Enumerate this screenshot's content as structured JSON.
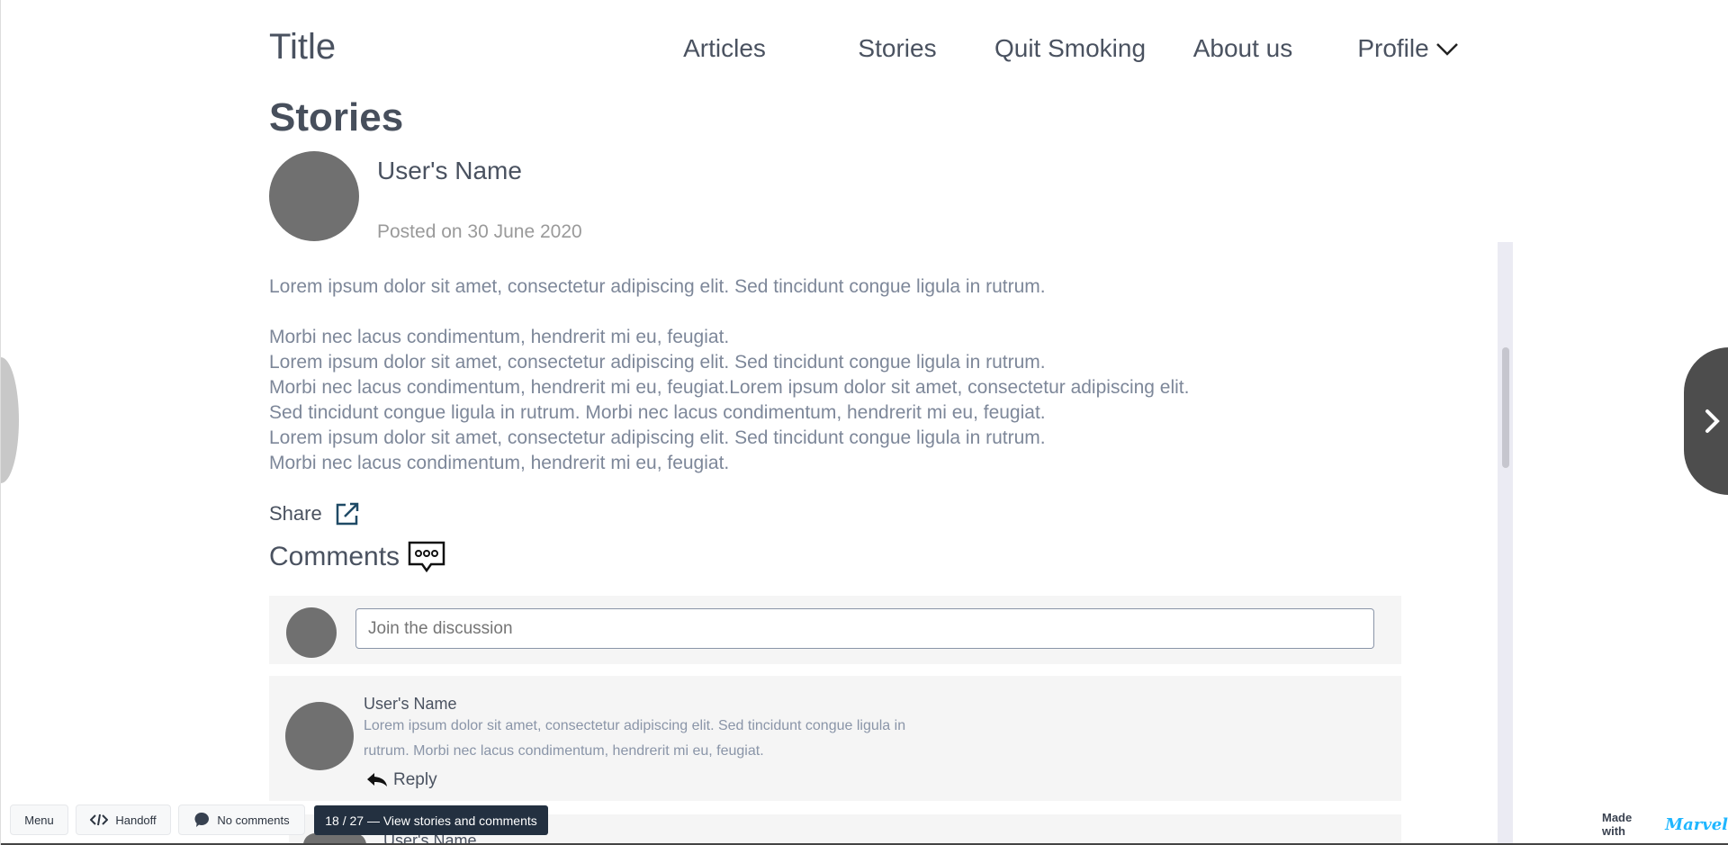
{
  "header": {
    "title": "Title",
    "nav": [
      "Articles",
      "Stories",
      "Quit Smoking",
      "About us",
      "Profile"
    ]
  },
  "page": {
    "heading": "Stories"
  },
  "post": {
    "user_name": "User's Name",
    "posted": "Posted on 30 June 2020",
    "body": "Lorem ipsum dolor sit amet, consectetur adipiscing elit. Sed tincidunt congue ligula in rutrum.\n\nMorbi nec lacus condimentum, hendrerit mi eu, feugiat.\nLorem ipsum dolor sit amet, consectetur adipiscing elit. Sed tincidunt congue ligula in rutrum.\nMorbi nec lacus condimentum, hendrerit mi eu, feugiat.Lorem ipsum dolor sit amet, consectetur adipiscing elit.\nSed tincidunt congue ligula in rutrum. Morbi nec lacus condimentum, hendrerit mi eu, feugiat.\nLorem ipsum dolor sit amet, consectetur adipiscing elit. Sed tincidunt congue ligula in rutrum.\nMorbi nec lacus condimentum, hendrerit mi eu, feugiat.",
    "share_label": "Share"
  },
  "comments": {
    "heading": "Comments",
    "input_placeholder": "Join the discussion",
    "items": [
      {
        "user_name": "User's Name",
        "line1": "Lorem ipsum dolor sit amet, consectetur adipiscing elit. Sed tincidunt congue ligula in",
        "line2": "rutrum. Morbi nec lacus condimentum, hendrerit mi eu, feugiat.",
        "reply_label": "Reply"
      },
      {
        "user_name": "User's Name"
      }
    ]
  },
  "toolbar": {
    "menu": "Menu",
    "handoff": "Handoff",
    "comments": "No comments",
    "tooltip": "18 / 27 — View stories and comments",
    "made_with": "Made with",
    "brand": "Marvel"
  },
  "colors": {
    "accent": "#1fb6ff",
    "tooltip_bg": "#233040",
    "nav_circle": "#4d4d4d"
  }
}
